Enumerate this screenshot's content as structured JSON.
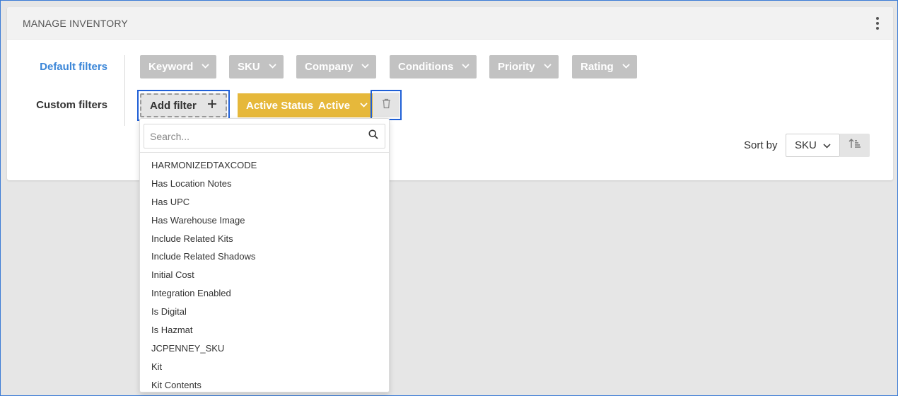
{
  "header": {
    "title": "MANAGE INVENTORY"
  },
  "filters": {
    "default_label": "Default filters",
    "custom_label": "Custom filters",
    "default_chips": [
      "Keyword",
      "SKU",
      "Company",
      "Conditions",
      "Priority",
      "Rating"
    ],
    "add_filter_label": "Add filter",
    "active_chip": {
      "name": "Active Status",
      "value": "Active"
    }
  },
  "sort": {
    "label": "Sort by",
    "selected": "SKU"
  },
  "dropdown": {
    "search_placeholder": "Search...",
    "options": [
      "HARMONIZEDTAXCODE",
      "Has Location Notes",
      "Has UPC",
      "Has Warehouse Image",
      "Include Related Kits",
      "Include Related Shadows",
      "Initial Cost",
      "Integration Enabled",
      "Is Digital",
      "Is Hazmat",
      "JCPENNEY_SKU",
      "Kit",
      "Kit Contents"
    ]
  },
  "colors": {
    "accent_blue": "#3b86d8",
    "highlight_border": "#1f5fd6",
    "chip_gray": "#c2c2c2",
    "active_chip": "#e6b83b"
  },
  "icons": [
    "kebab-menu-icon",
    "chevron-down-icon",
    "plus-icon",
    "trash-icon",
    "search-icon",
    "sort-ascending-icon"
  ]
}
